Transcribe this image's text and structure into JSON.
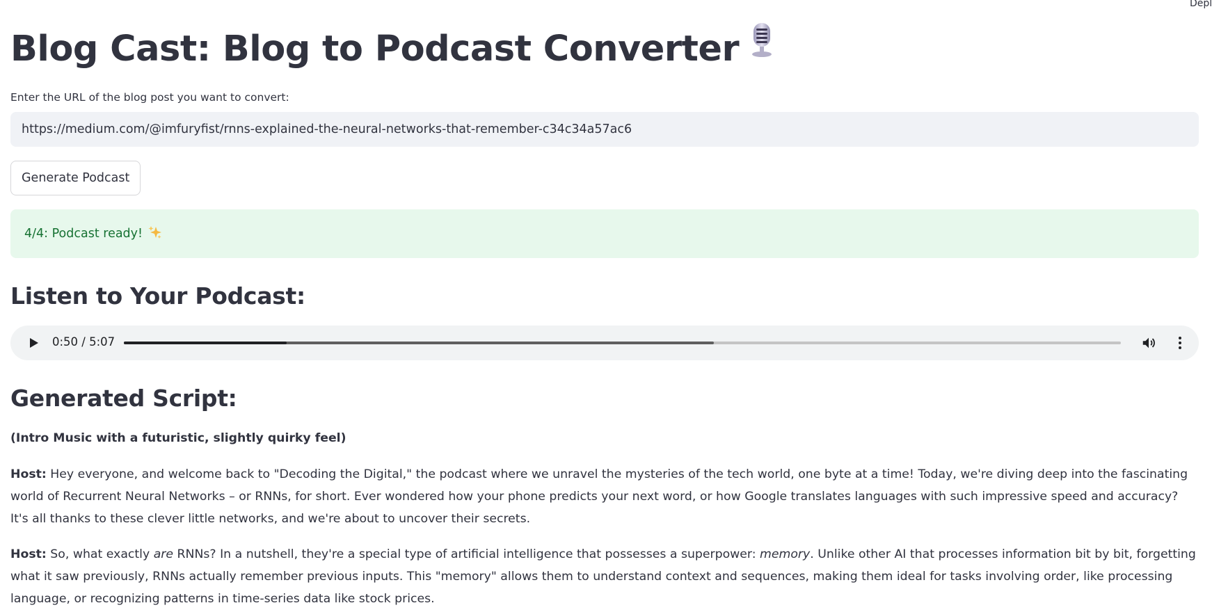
{
  "header": {
    "deploy_label": "Deploy"
  },
  "app": {
    "title": "Blog Cast: Blog to Podcast Converter",
    "title_icon": "microphone-icon"
  },
  "form": {
    "url_label": "Enter the URL of the blog post you want to convert:",
    "url_value": "https://medium.com/@imfuryfist/rnns-explained-the-neural-networks-that-remember-c34c34a57ac6",
    "generate_button": "Generate Podcast"
  },
  "status": {
    "message": "4/4: Podcast ready!",
    "icon": "sparkles-icon",
    "color": "#177233",
    "background": "#e7f8ec"
  },
  "listen": {
    "heading": "Listen to Your Podcast:",
    "player": {
      "time": "0:50 / 5:07",
      "played_fraction": 0.163,
      "buffered_fraction": 0.592
    }
  },
  "script": {
    "heading": "Generated Script:",
    "intro": "(Intro Music with a futuristic, slightly quirky feel)",
    "paragraphs": [
      {
        "speaker": "Host:",
        "text": " Hey everyone, and welcome back to \"Decoding the Digital,\" the podcast where we unravel the mysteries of the tech world, one byte at a time! Today, we're diving deep into the fascinating world of Recurrent Neural Networks – or RNNs, for short. Ever wondered how your phone predicts your next word, or how Google translates languages with such impressive speed and accuracy? It's all thanks to these clever little networks, and we're about to uncover their secrets."
      },
      {
        "speaker": "Host:",
        "text_a": " So, what exactly ",
        "em_a": "are",
        "text_b": " RNNs? In a nutshell, they're a special type of artificial intelligence that possesses a superpower: ",
        "em_b": "memory",
        "text_c": ". Unlike other AI that processes information bit by bit, forgetting what it saw previously, RNNs actually remember previous inputs. This \"memory\" allows them to understand context and sequences, making them ideal for tasks involving order, like processing language, or recognizing patterns in time-series data like stock prices."
      }
    ]
  }
}
